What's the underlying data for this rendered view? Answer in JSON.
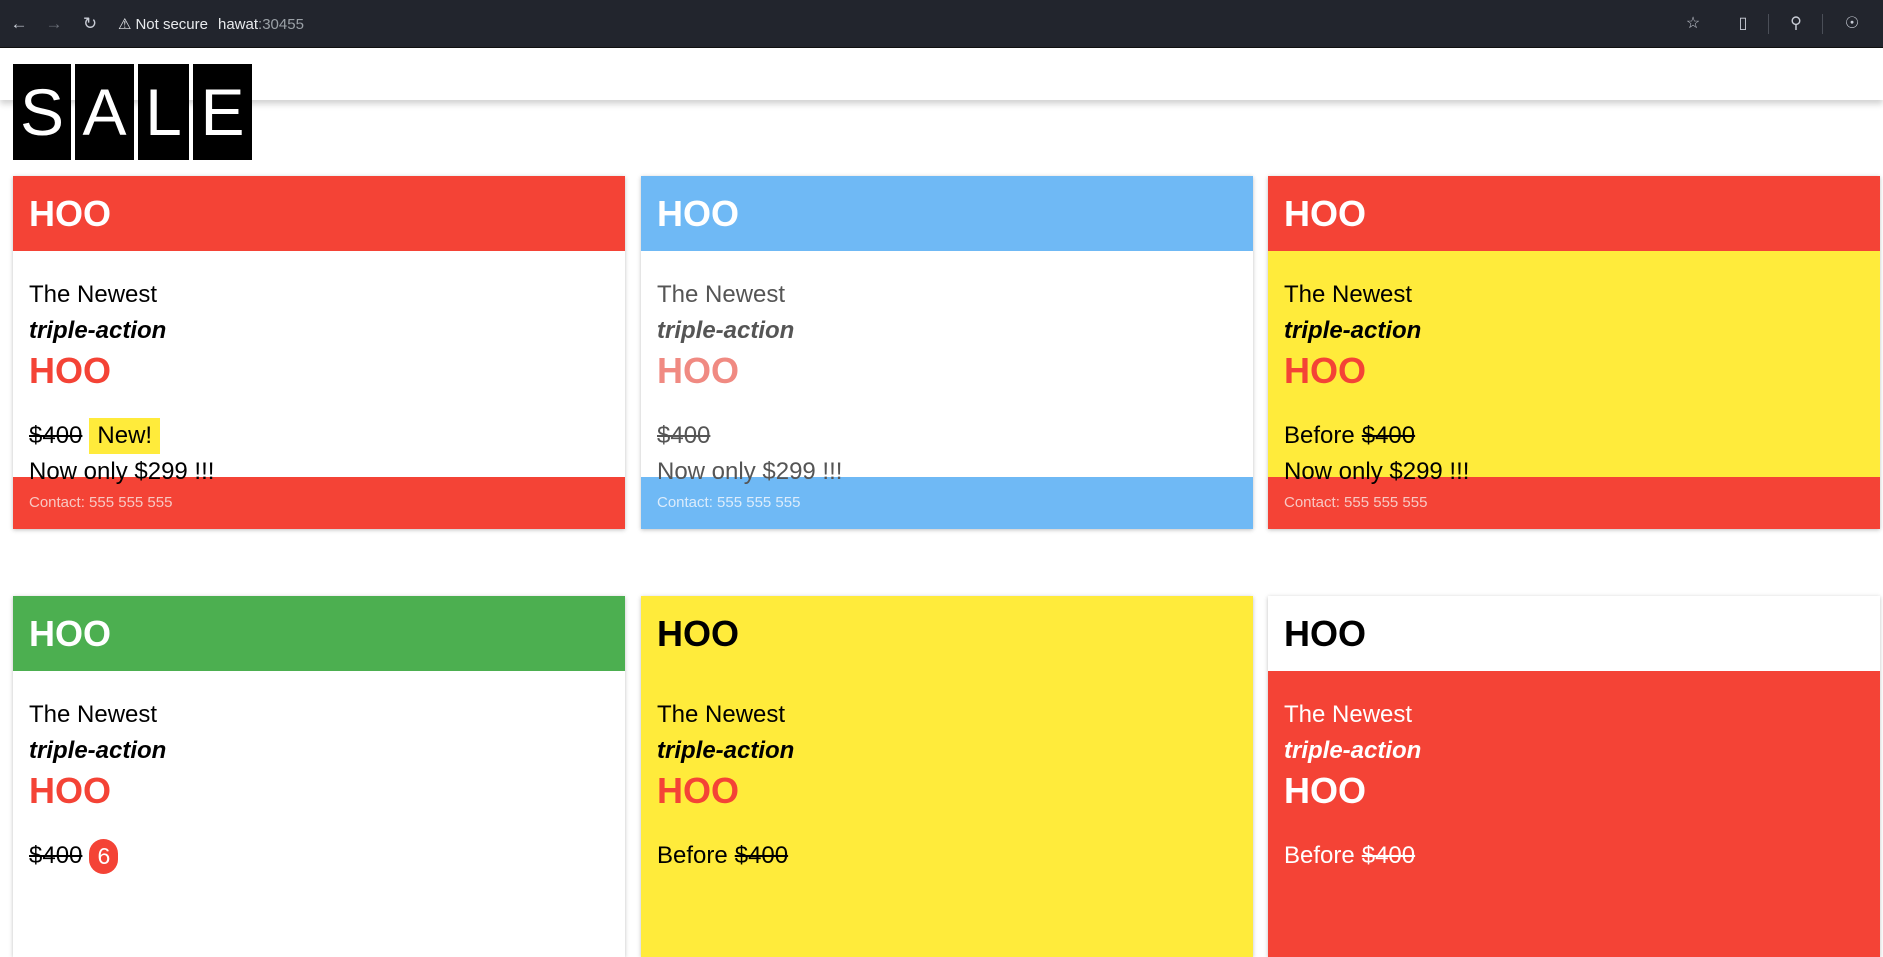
{
  "browser": {
    "security_label": "Not secure",
    "host": "hawat",
    "port": ":30455"
  },
  "logo": {
    "letters": [
      "S",
      "A",
      "L",
      "E"
    ]
  },
  "colors": {
    "red": "#f44336",
    "blue": "#6fb9f5",
    "yellow": "#ffeb3b",
    "green": "#4caf50",
    "white": "#ffffff"
  },
  "cards": [
    {
      "title": "HOO",
      "line1": "The Newest",
      "line2": "triple-action",
      "product": "HOO",
      "before_prefix": "",
      "old_price": "$400",
      "tag": "New!",
      "offer": "Now only $299 !!!",
      "contact": "Contact: 555 555 555"
    },
    {
      "title": "HOO",
      "line1": "The Newest",
      "line2": "triple-action",
      "product": "HOO",
      "before_prefix": "",
      "old_price": "$400",
      "offer": "Now only $299 !!!",
      "contact": "Contact: 555 555 555"
    },
    {
      "title": "HOO",
      "line1": "The Newest",
      "line2": "triple-action",
      "product": "HOO",
      "before_prefix": "Before",
      "old_price": "$400",
      "offer": "Now only $299 !!!",
      "contact": "Contact: 555 555 555"
    },
    {
      "title": "HOO",
      "line1": "The Newest",
      "line2": "triple-action",
      "product": "HOO",
      "before_prefix": "",
      "old_price": "$400",
      "badge": "6"
    },
    {
      "title": "HOO",
      "line1": "The Newest",
      "line2": "triple-action",
      "product": "HOO",
      "before_prefix": "Before",
      "old_price": "$400"
    },
    {
      "title": "HOO",
      "line1": "The Newest",
      "line2": "triple-action",
      "product": "HOO",
      "before_prefix": "Before",
      "old_price": "$400"
    }
  ]
}
